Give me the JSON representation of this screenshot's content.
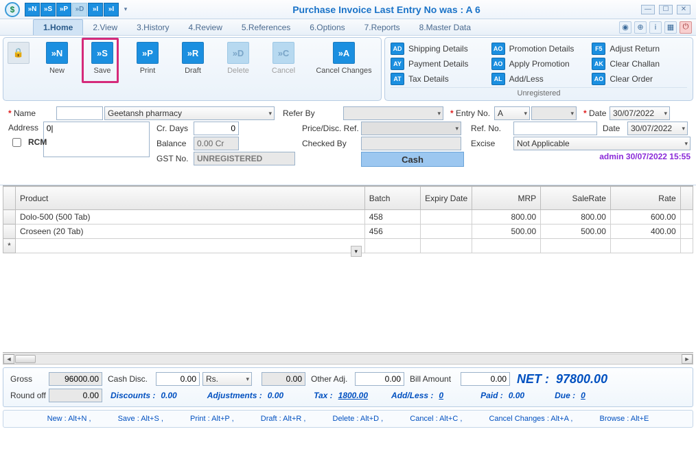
{
  "title": "Purchase Invoice    Last Entry No was : A 6",
  "qa_buttons": [
    "»N",
    "»S",
    "»P",
    "»D",
    "»I",
    "»I"
  ],
  "menu": [
    "1.Home",
    "2.View",
    "3.History",
    "4.Review",
    "5.References",
    "6.Options",
    "7.Reports",
    "8.Master Data"
  ],
  "toolbar_left": [
    {
      "code": "🔒",
      "label": "",
      "dim": true,
      "lock": true
    },
    {
      "code": "»N",
      "label": "New"
    },
    {
      "code": "»S",
      "label": "Save",
      "hl": true
    },
    {
      "code": "»P",
      "label": "Print"
    },
    {
      "code": "»R",
      "label": "Draft"
    },
    {
      "code": "»D",
      "label": "Delete",
      "dim": true
    },
    {
      "code": "»C",
      "label": "Cancel",
      "dim": true
    },
    {
      "code": "»A",
      "label": "Cancel Changes"
    }
  ],
  "toolbar_right": [
    {
      "k": "AD",
      "t": "Shipping Details"
    },
    {
      "k": "AO",
      "t": "Promotion Details"
    },
    {
      "k": "F5",
      "t": "Adjust Return"
    },
    {
      "k": "AY",
      "t": "Payment Details"
    },
    {
      "k": "AO",
      "t": "Apply Promotion"
    },
    {
      "k": "AK",
      "t": "Clear Challan"
    },
    {
      "k": "AT",
      "t": "Tax Details"
    },
    {
      "k": "AL",
      "t": "Add/Less"
    },
    {
      "k": "AO",
      "t": "Clear Order"
    }
  ],
  "toolbar_right_footer": "Unregistered",
  "form": {
    "name_label": "Name",
    "name_value": "Geetansh pharmacy",
    "name_code": "",
    "address_label": "Address",
    "address_value": "0|",
    "rcm_label": "RCM",
    "crdays_label": "Cr. Days",
    "crdays_value": "0",
    "balance_label": "Balance",
    "balance_value": "0.00 Cr",
    "gstno_label": "GST No.",
    "gstno_value": "UNREGISTERED",
    "referby_label": "Refer By",
    "referby_value": "",
    "pricedisc_label": "Price/Disc. Ref.",
    "pricedisc_value": "",
    "checkedby_label": "Checked By",
    "checkedby_value": "",
    "cash_label": "Cash",
    "entryno_label": "Entry No.",
    "entryno_series": "A",
    "entryno_num": "",
    "refno_label": "Ref. No.",
    "refno_value": "",
    "excise_label": "Excise",
    "excise_value": "Not Applicable",
    "date_label": "Date",
    "date1": "30/07/2022",
    "date2": "30/07/2022",
    "stamp": "admin 30/07/2022 15:55"
  },
  "grid": {
    "cols": [
      "Product",
      "Batch",
      "Expiry Date",
      "MRP",
      "SaleRate",
      "Rate"
    ],
    "rows": [
      {
        "product": "Dolo-500 (500 Tab)",
        "batch": "458",
        "expiry": "",
        "mrp": "800.00",
        "sale": "800.00",
        "rate": "600.00"
      },
      {
        "product": "Croseen (20 Tab)",
        "batch": "456",
        "expiry": "",
        "mrp": "500.00",
        "sale": "500.00",
        "rate": "400.00"
      }
    ],
    "newrow_mark": "*"
  },
  "totals": {
    "gross_label": "Gross",
    "gross": "96000.00",
    "cashdisc_label": "Cash Disc.",
    "cashdisc": "0.00",
    "cashdisc_unit": "Rs.",
    "cashdisc_amt": "0.00",
    "otheradj_label": "Other Adj.",
    "otheradj": "0.00",
    "billamt_label": "Bill Amount",
    "billamt": "0.00",
    "net_label": "NET :",
    "net": "97800.00",
    "roundoff_label": "Round off",
    "roundoff": "0.00",
    "discounts_label": "Discounts :",
    "discounts": "0.00",
    "adjustments_label": "Adjustments :",
    "adjustments": "0.00",
    "tax_label": "Tax :",
    "tax": "1800.00",
    "addless_label": "Add/Less :",
    "addless": "0",
    "paid_label": "Paid :",
    "paid": "0.00",
    "due_label": "Due :",
    "due": "0"
  },
  "shortcuts": [
    "New : Alt+N ,",
    "Save : Alt+S ,",
    "Print : Alt+P ,",
    "Draft : Alt+R ,",
    "Delete : Alt+D ,",
    "Cancel : Alt+C ,",
    "Cancel Changes : Alt+A ,",
    "Browse : Alt+E"
  ]
}
